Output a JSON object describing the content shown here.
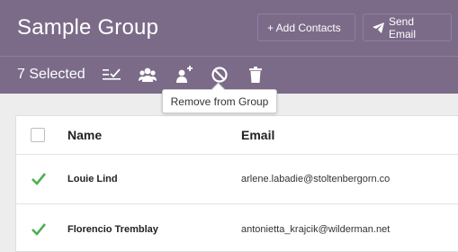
{
  "header": {
    "title": "Sample Group",
    "add_contacts_label": "+ Add Contacts",
    "send_email_label": "Send Email",
    "bg_color": "#7b6b89"
  },
  "toolbar": {
    "selected_label": "7 Selected",
    "icons": [
      "select-list-icon",
      "group-users-icon",
      "add-to-group-icon",
      "remove-block-icon",
      "trash-icon"
    ],
    "tooltip": "Remove from Group"
  },
  "table": {
    "columns": [
      "Name",
      "Email"
    ],
    "rows": [
      {
        "name": "Louie Lind",
        "email": "arlene.labadie@stoltenbergorn.co",
        "checked": true
      },
      {
        "name": "Florencio Tremblay",
        "email": "antonietta_krajcik@wilderman.net",
        "checked": true
      }
    ],
    "check_color": "#4caf50"
  }
}
